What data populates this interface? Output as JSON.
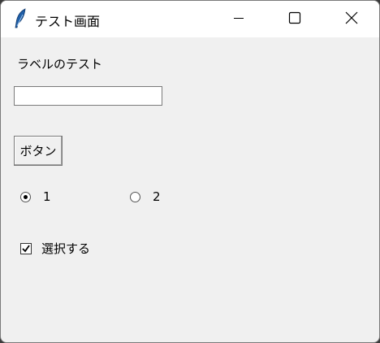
{
  "window": {
    "title": "テスト画面",
    "icons": {
      "app": "feather-icon",
      "minimize": "minimize-icon",
      "maximize": "maximize-icon",
      "close": "close-icon"
    }
  },
  "form": {
    "label": "ラベルのテスト",
    "entry_value": "",
    "button_label": "ボタン",
    "radios": [
      {
        "label": "1",
        "checked": true
      },
      {
        "label": "2",
        "checked": false
      }
    ],
    "checkbox": {
      "label": "選択する",
      "checked": true
    }
  },
  "colors": {
    "titlebar": "#ffffff",
    "window_bg": "#f0f0f0",
    "desktop": "#3b3b3b"
  }
}
